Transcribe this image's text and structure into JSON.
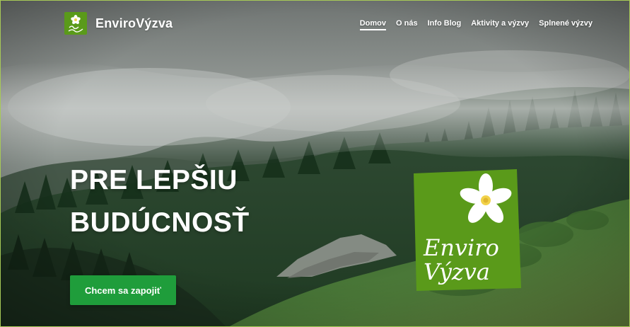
{
  "header": {
    "brand": "EnviroVýzva",
    "logo_text": "Enviro Výzva",
    "nav": [
      {
        "label": "Domov",
        "active": true
      },
      {
        "label": "O nás",
        "active": false
      },
      {
        "label": "Info Blog",
        "active": false
      },
      {
        "label": "Aktivity a výzvy",
        "active": false
      },
      {
        "label": "Splnené výzvy",
        "active": false
      }
    ]
  },
  "hero": {
    "headline_line1": "PRE LEPŠIU",
    "headline_line2": "BUDÚCNOSŤ",
    "cta_label": "Chcem sa zapojiť",
    "badge_line1": "Enviro",
    "badge_line2": "Výzva"
  },
  "colors": {
    "brand_green": "#5a9a1a",
    "cta_green": "#1f9d3b",
    "frame_border": "#a7c957"
  }
}
